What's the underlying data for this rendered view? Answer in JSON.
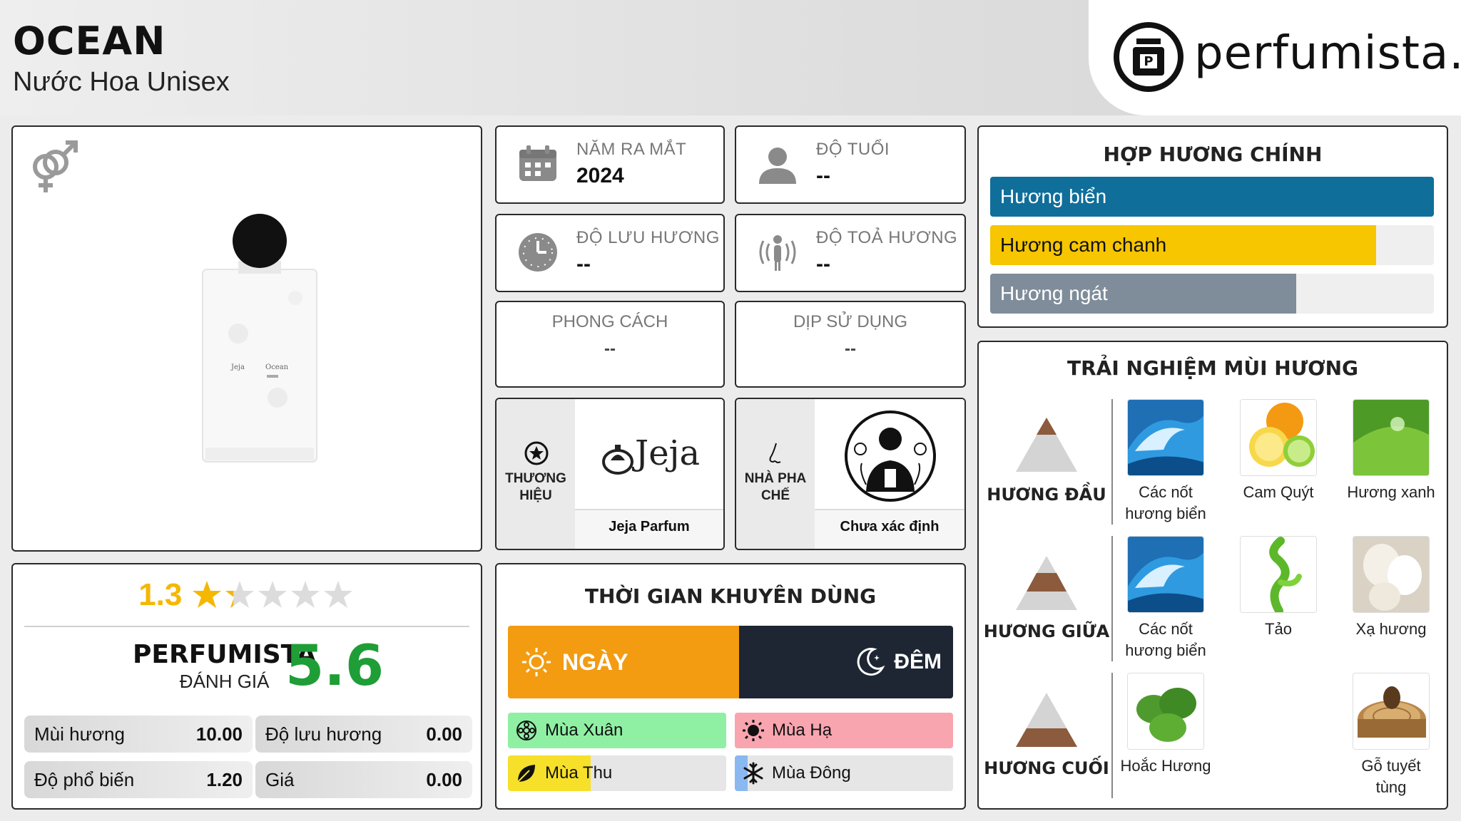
{
  "header": {
    "title": "OCEAN",
    "subtitle": "Nước Hoa Unisex",
    "logo_text": "perfumista.vn"
  },
  "product": {
    "gender_icon": "unisex-icon",
    "bottle_brand": "Jeja",
    "bottle_name": "Ocean"
  },
  "rating": {
    "value": "1.3",
    "stars_max": 5,
    "stars_filled": 1.3,
    "perfumista_label": "PERFUMISTA",
    "perfumista_sub": "ĐÁNH GIÁ",
    "perfumista_score": "5.6",
    "metrics": [
      {
        "label": "Mùi hương",
        "value": "10.00"
      },
      {
        "label": "Độ lưu hương",
        "value": "0.00"
      },
      {
        "label": "Độ phổ biến",
        "value": "1.20"
      },
      {
        "label": "Giá",
        "value": "0.00"
      }
    ]
  },
  "info": {
    "year": {
      "label": "NĂM RA MẮT",
      "value": "2024",
      "icon": "calendar-icon"
    },
    "age": {
      "label": "ĐỘ TUỔI",
      "value": "--",
      "icon": "user-icon"
    },
    "longevity": {
      "label": "ĐỘ LƯU HƯƠNG",
      "value": "--",
      "icon": "clock-icon"
    },
    "sillage": {
      "label": "ĐỘ TOẢ HƯƠNG",
      "value": "--",
      "icon": "sillage-icon"
    },
    "style": {
      "label": "PHONG CÁCH",
      "value": "--"
    },
    "occasion": {
      "label": "DỊP SỬ DỤNG",
      "value": "--"
    },
    "brand": {
      "label": "THƯƠNG HIỆU",
      "name": "Jeja Parfum",
      "logo_text": "Jeja",
      "icon": "star-badge-icon"
    },
    "perfumer": {
      "label": "NHÀ PHA CHẾ",
      "name": "Chưa xác định",
      "icon": "nose-icon"
    }
  },
  "accords": {
    "title": "HỢP HƯƠNG CHÍNH",
    "items": [
      {
        "label": "Hương biển",
        "percent": 100,
        "color": "#0f6e9a",
        "text_color": "#ffffff"
      },
      {
        "label": "Hương cam chanh",
        "percent": 87,
        "color": "#f7c600",
        "text_color": "#111111"
      },
      {
        "label": "Hương ngát",
        "percent": 69,
        "color": "#7f8c9a",
        "text_color": "#ffffff"
      }
    ]
  },
  "recommended": {
    "title": "THỜI GIAN KHUYÊN DÙNG",
    "day_label": "NGÀY",
    "night_label": "ĐÊM",
    "day_percent": 52,
    "seasons": [
      {
        "label": "Mùa Xuân",
        "percent": 100,
        "color": "#8ff0a4",
        "icon": "spring-flower-icon"
      },
      {
        "label": "Mùa Hạ",
        "percent": 100,
        "color": "#f8a5b0",
        "icon": "sun-icon"
      },
      {
        "label": "Mùa Thu",
        "percent": 38,
        "color": "#f6e02a",
        "icon": "leaf-icon"
      },
      {
        "label": "Mùa Đông",
        "percent": 6,
        "color": "#8ab8f0",
        "icon": "snowflake-icon"
      }
    ]
  },
  "experience": {
    "title": "TRẢI NGHIỆM MÙI HƯƠNG",
    "rows": [
      {
        "label": "HƯƠNG ĐẦU",
        "notes": [
          {
            "name": "Các nốt hương biển",
            "line1": "Các nốt",
            "line2": "hương biển",
            "img": "wave"
          },
          {
            "name": "Cam Quýt",
            "line1": "Cam Quýt",
            "line2": "",
            "img": "citrus"
          },
          {
            "name": "Hương xanh",
            "line1": "Hương xanh",
            "line2": "",
            "img": "green"
          }
        ]
      },
      {
        "label": "HƯƠNG GIỮA",
        "notes": [
          {
            "name": "Các nốt hương biển",
            "line1": "Các nốt",
            "line2": "hương biển",
            "img": "wave"
          },
          {
            "name": "Tảo",
            "line1": "Tảo",
            "line2": "",
            "img": "algae"
          },
          {
            "name": "Xạ hương",
            "line1": "Xạ hương",
            "line2": "",
            "img": "musk"
          }
        ]
      },
      {
        "label": "HƯƠNG CUỐI",
        "notes": [
          {
            "name": "Hoắc Hương",
            "line1": "Hoắc Hương",
            "line2": "",
            "img": "patchouli"
          },
          {
            "name": "Gỗ tuyết tùng",
            "line1": "Gỗ tuyết",
            "line2": "tùng",
            "img": "cedar"
          }
        ]
      }
    ]
  }
}
